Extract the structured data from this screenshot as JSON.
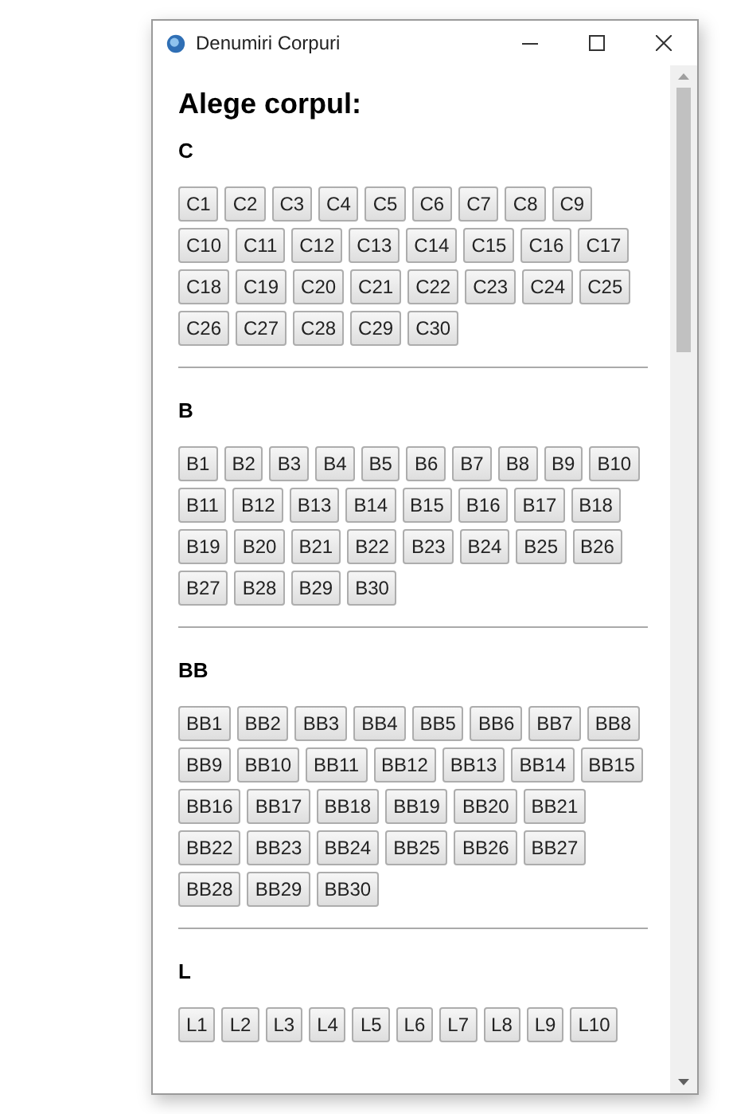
{
  "window": {
    "title": "Denumiri Corpuri"
  },
  "heading": "Alege corpul:",
  "sections": [
    {
      "title": "C",
      "buttons": [
        "C1",
        "C2",
        "C3",
        "C4",
        "C5",
        "C6",
        "C7",
        "C8",
        "C9",
        "C10",
        "C11",
        "C12",
        "C13",
        "C14",
        "C15",
        "C16",
        "C17",
        "C18",
        "C19",
        "C20",
        "C21",
        "C22",
        "C23",
        "C24",
        "C25",
        "C26",
        "C27",
        "C28",
        "C29",
        "C30"
      ]
    },
    {
      "title": "B",
      "buttons": [
        "B1",
        "B2",
        "B3",
        "B4",
        "B5",
        "B6",
        "B7",
        "B8",
        "B9",
        "B10",
        "B11",
        "B12",
        "B13",
        "B14",
        "B15",
        "B16",
        "B17",
        "B18",
        "B19",
        "B20",
        "B21",
        "B22",
        "B23",
        "B24",
        "B25",
        "B26",
        "B27",
        "B28",
        "B29",
        "B30"
      ]
    },
    {
      "title": "BB",
      "buttons": [
        "BB1",
        "BB2",
        "BB3",
        "BB4",
        "BB5",
        "BB6",
        "BB7",
        "BB8",
        "BB9",
        "BB10",
        "BB11",
        "BB12",
        "BB13",
        "BB14",
        "BB15",
        "BB16",
        "BB17",
        "BB18",
        "BB19",
        "BB20",
        "BB21",
        "BB22",
        "BB23",
        "BB24",
        "BB25",
        "BB26",
        "BB27",
        "BB28",
        "BB29",
        "BB30"
      ]
    },
    {
      "title": "L",
      "buttons": [
        "L1",
        "L2",
        "L3",
        "L4",
        "L5",
        "L6",
        "L7",
        "L8",
        "L9",
        "L10"
      ]
    }
  ]
}
